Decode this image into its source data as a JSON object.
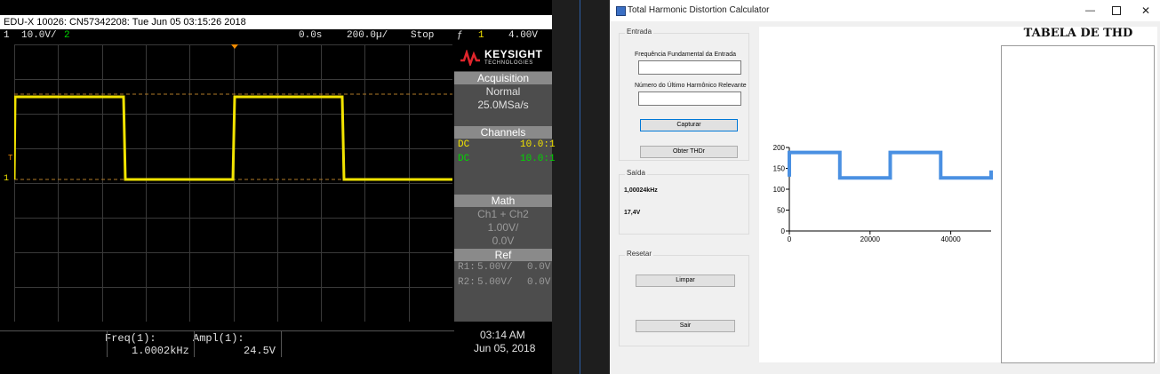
{
  "scope": {
    "title": "EDU-X 10026: CN57342208: Tue Jun 05 03:15:26 2018",
    "status": {
      "ch1_num": "1",
      "ch1_scale": "10.0V/",
      "ch2_num": "2",
      "time_offset": "0.0s",
      "time_scale": "200.0µ/",
      "run_state": "Stop",
      "trigger_icon": "ƒ",
      "trigger_ch": "1",
      "trigger_level": "4.00V"
    },
    "brand": {
      "name": "KEYSIGHT",
      "sub": "TECHNOLOGIES"
    },
    "acquisition": {
      "header": "Acquisition",
      "mode": "Normal",
      "rate": "25.0MSa/s"
    },
    "channels": {
      "header": "Channels",
      "rows": [
        {
          "coupling": "DC",
          "probe": "10.0:1"
        },
        {
          "coupling": "DC",
          "probe": "10.0:1"
        }
      ]
    },
    "math": {
      "header": "Math",
      "expr": "Ch1 + Ch2",
      "scale": "1.00V/",
      "offset": "0.0V"
    },
    "ref": {
      "header": "Ref",
      "rows": [
        {
          "name": "R1:",
          "scale": "5.00V/",
          "offset": "0.0V"
        },
        {
          "name": "R2:",
          "scale": "5.00V/",
          "offset": "0.0V"
        }
      ]
    },
    "markers": {
      "trigger_t": "T",
      "ground_1": "1"
    },
    "measurements": {
      "freq_label": "Freq(1):",
      "freq_value": "1.0002kHz",
      "ampl_label": "Ampl(1):",
      "ampl_value": "24.5V"
    },
    "clock": {
      "time": "03:14 AM",
      "date": "Jun 05, 2018"
    },
    "colors": {
      "ch1": "#f2e300",
      "ch2": "#00d600",
      "trace_ref": "#c88a2a"
    }
  },
  "app": {
    "title": "Total Harmonic Distortion Calculator",
    "window_icon": "app-icon",
    "entrada": {
      "title": "Entrada",
      "freq_label": "Frequência Fundamental da Entrada",
      "freq_value": "",
      "harm_label": "Número do Último Harmônico Relevante",
      "harm_value": "",
      "capturar": "Capturar",
      "obter": "Obter THDr"
    },
    "saida": {
      "title": "Saída",
      "freq": "1,00024kHz",
      "ampl": "17,4V"
    },
    "resetar": {
      "title": "Resetar",
      "limpar": "Limpar",
      "sair": "Sair"
    },
    "tabela_title": "TABELA DE THD",
    "accent": "#4a90e2"
  },
  "chart_data": {
    "type": "line",
    "title": "",
    "xlabel": "",
    "ylabel": "",
    "xlim": [
      0,
      50000
    ],
    "ylim": [
      0,
      200
    ],
    "xticks": [
      "0",
      "20000",
      "40000"
    ],
    "yticks": [
      "200",
      "150",
      "100",
      "50",
      "0"
    ],
    "series": [
      {
        "x": [
          0,
          0,
          12500,
          12500,
          25000,
          25000,
          37500,
          37500,
          50000,
          50000
        ],
        "y": [
          130,
          188,
          188,
          127,
          127,
          188,
          188,
          127,
          127,
          145
        ]
      }
    ]
  }
}
